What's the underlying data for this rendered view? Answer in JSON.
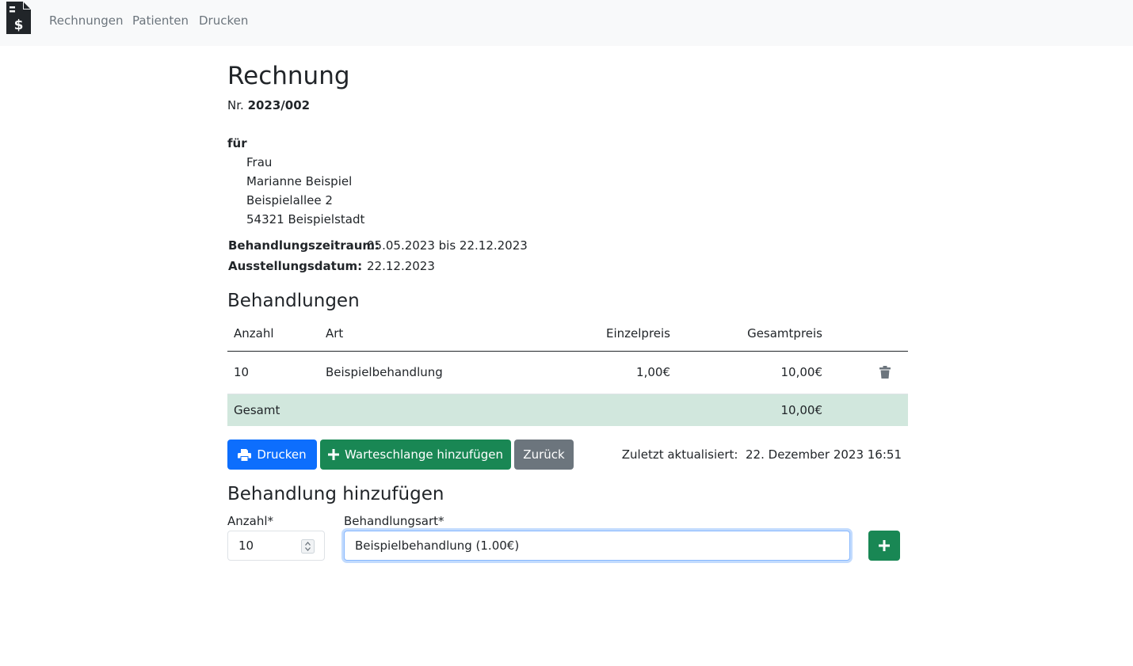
{
  "nav": {
    "links": [
      "Rechnungen",
      "Patienten",
      "Drucken"
    ]
  },
  "invoice": {
    "title": "Rechnung",
    "number_prefix": "Nr.",
    "number": "2023/002",
    "recipient_label": "für",
    "recipient_lines": [
      "Frau",
      "Marianne Beispiel",
      "Beispielallee 2",
      "54321 Beispielstadt"
    ],
    "period_label": "Behandlungszeitraum:",
    "period_value": "05.05.2023 bis 22.12.2023",
    "issue_label": "Ausstellungsdatum:",
    "issue_value": "22.12.2023"
  },
  "treatments": {
    "heading": "Behandlungen",
    "columns": [
      "Anzahl",
      "Art",
      "Einzelpreis",
      "Gesamtpreis"
    ],
    "rows": [
      {
        "anzahl": "10",
        "art": "Beispielbehandlung",
        "einzelpreis": "1,00€",
        "gesamtpreis": "10,00€"
      }
    ],
    "total_label": "Gesamt",
    "total_value": "10,00€"
  },
  "actions": {
    "print_label": "Drucken",
    "queue_label": "Warteschlange hinzufügen",
    "back_label": "Zurück",
    "updated_label": "Zuletzt aktualisiert:",
    "updated_value": "22. Dezember 2023 16:51"
  },
  "add_form": {
    "heading": "Behandlung hinzufügen",
    "anzahl_label": "Anzahl*",
    "anzahl_value": "10",
    "art_label": "Behandlungsart*",
    "art_value": "Beispielbehandlung (1.00€)"
  },
  "colors": {
    "primary": "#0d6efd",
    "success": "#198754",
    "secondary": "#6c757d",
    "total_row": "#d1e7dd"
  }
}
